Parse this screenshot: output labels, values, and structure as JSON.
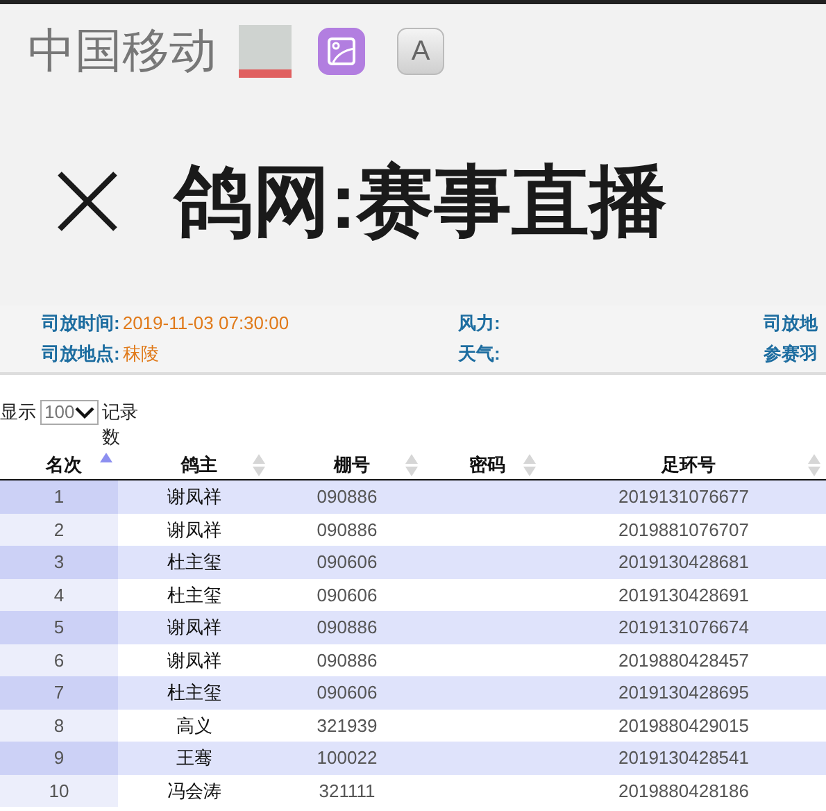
{
  "status_bar": {
    "carrier": "中国移动",
    "app_icon_letter": "A"
  },
  "header": {
    "title": "鸽网:赛事直播"
  },
  "info": [
    {
      "label": "司放时间:",
      "value": "2019-11-03 07:30:00"
    },
    {
      "label": "风力:"
    },
    {
      "label": "司放地"
    },
    {
      "label": "司放地点:",
      "value": "秣陵"
    },
    {
      "label": "天气:"
    },
    {
      "label": "参赛羽"
    }
  ],
  "length_control": {
    "prefix": "显示",
    "value": "100",
    "suffix": "记录数"
  },
  "table": {
    "columns": [
      {
        "label": "名次",
        "sorted": true
      },
      {
        "label": "鸽主",
        "sorted": false
      },
      {
        "label": "棚号",
        "sorted": false
      },
      {
        "label": "密码",
        "sorted": false
      },
      {
        "label": "足环号",
        "sorted": false
      }
    ],
    "rows": [
      [
        "1",
        "谢凤祥",
        "090886",
        "",
        "2019131076677"
      ],
      [
        "2",
        "谢凤祥",
        "090886",
        "",
        "2019881076707"
      ],
      [
        "3",
        "杜主玺",
        "090606",
        "",
        "2019130428681"
      ],
      [
        "4",
        "杜主玺",
        "090606",
        "",
        "2019130428691"
      ],
      [
        "5",
        "谢凤祥",
        "090886",
        "",
        "2019131076674"
      ],
      [
        "6",
        "谢凤祥",
        "090886",
        "",
        "2019880428457"
      ],
      [
        "7",
        "杜主玺",
        "090606",
        "",
        "2019130428695"
      ],
      [
        "8",
        "高义",
        "321939",
        "",
        "2019880429015"
      ],
      [
        "9",
        "王骞",
        "100022",
        "",
        "2019130428541"
      ],
      [
        "10",
        "冯会涛",
        "321111",
        "",
        "2019880428186"
      ]
    ]
  }
}
